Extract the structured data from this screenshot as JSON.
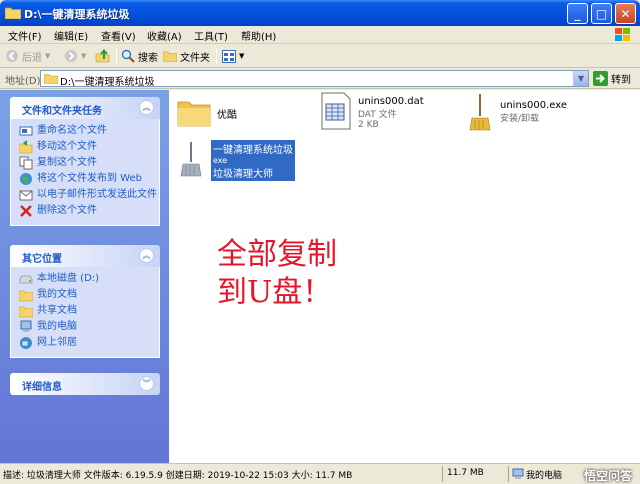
{
  "window": {
    "title": "D:\\一键清理系统垃圾",
    "controls": {
      "minimize": "_",
      "maximize": "□",
      "close": "✕"
    }
  },
  "menu": {
    "items": [
      "文件(F)",
      "编辑(E)",
      "查看(V)",
      "收藏(A)",
      "工具(T)",
      "帮助(H)"
    ]
  },
  "toolbar": {
    "back_label": "后退",
    "search_label": "搜索",
    "folders_label": "文件夹"
  },
  "address": {
    "label": "地址(D)",
    "path": "D:\\一键清理系统垃圾",
    "go_label": "转到"
  },
  "tasks": {
    "title": "文件和文件夹任务",
    "items": [
      {
        "label": "重命名这个文件",
        "icon": "rename-icon"
      },
      {
        "label": "移动这个文件",
        "icon": "move-icon"
      },
      {
        "label": "复制这个文件",
        "icon": "copy-icon"
      },
      {
        "label": "将这个文件发布到 Web",
        "icon": "publish-web-icon"
      },
      {
        "label": "以电子邮件形式发送此文件",
        "icon": "email-icon"
      },
      {
        "label": "删除这个文件",
        "icon": "delete-icon"
      }
    ]
  },
  "places": {
    "title": "其它位置",
    "items": [
      {
        "label": "本地磁盘 (D:)",
        "icon": "drive-icon"
      },
      {
        "label": "我的文档",
        "icon": "folder-icon"
      },
      {
        "label": "共享文档",
        "icon": "folder-icon"
      },
      {
        "label": "我的电脑",
        "icon": "computer-icon"
      },
      {
        "label": "网上邻居",
        "icon": "network-icon"
      }
    ]
  },
  "details": {
    "title": "详细信息"
  },
  "files": [
    {
      "name": "优酷",
      "type": "",
      "size": ""
    },
    {
      "name": "unins000.dat",
      "type": "DAT 文件",
      "size": "2 KB"
    },
    {
      "name": "unins000.exe",
      "type": "安装/卸载",
      "size": ""
    },
    {
      "name": "一键清理系统垃圾",
      "type": "exe",
      "size": "垃圾清理大师"
    }
  ],
  "annotation": {
    "line1": "全部复制",
    "line2": "到U盘！"
  },
  "status": {
    "description": "描述: 垃圾清理大师 文件版本: 6.19.5.9 创建日期: 2019-10-22 15:03 大小: 11.7 MB",
    "size": "11.7 MB",
    "location": "我的电脑",
    "watermark": "悟空问答"
  },
  "colors": {
    "titlebar": "#0553df",
    "task_link": "#215dc6",
    "selection": "#316ac5",
    "annotation": "#e6162a"
  }
}
